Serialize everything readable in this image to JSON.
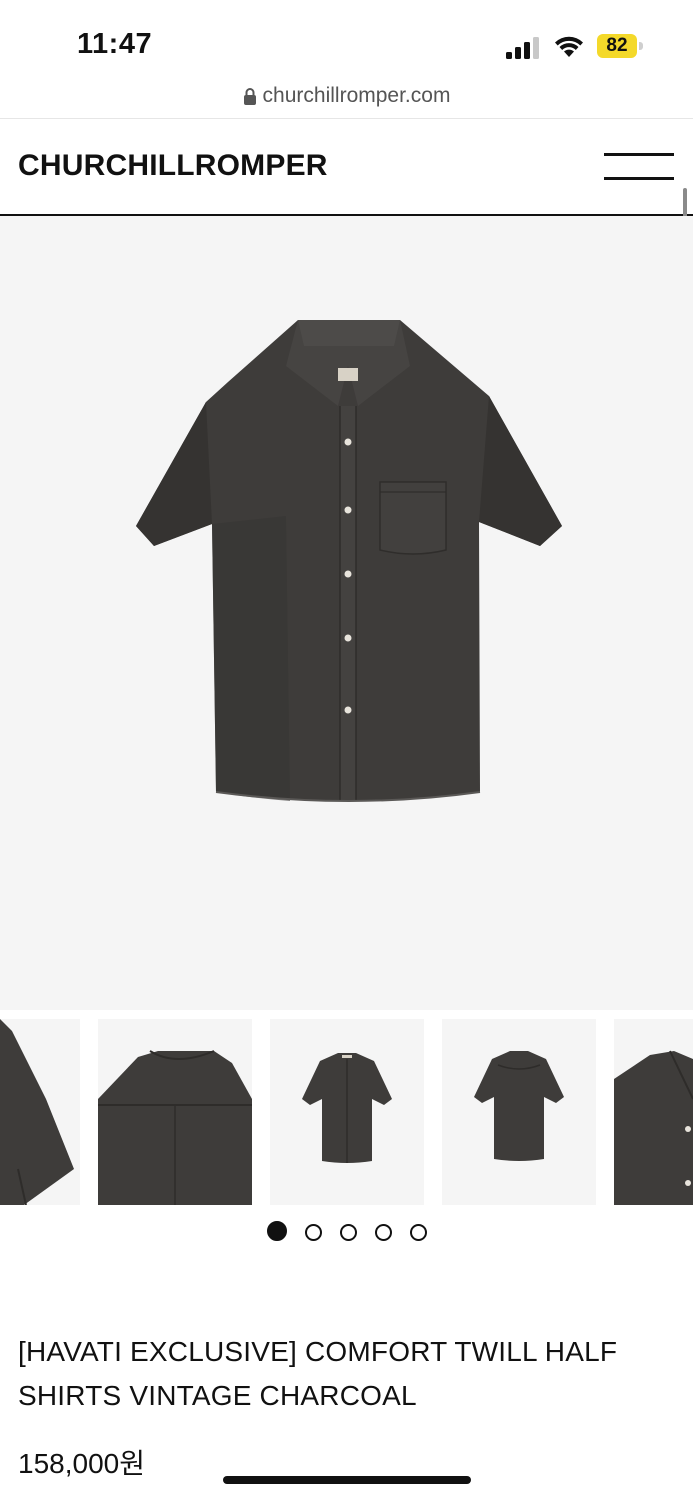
{
  "status_bar": {
    "time": "11:47",
    "battery_level": "82",
    "battery_color": "#f4d92a",
    "icons": [
      "cellular-signal-icon",
      "wifi-icon",
      "battery-icon"
    ]
  },
  "browser": {
    "url": "churchillromper.com",
    "lock_icon": "lock-icon"
  },
  "header": {
    "logo": "CHURCHILLROMPER",
    "menu_icon": "hamburger-menu-icon"
  },
  "gallery": {
    "main_image": "charcoal-short-sleeve-shirt-front",
    "thumbnails": [
      "shirt-sleeve-detail",
      "shirt-back-yoke-detail",
      "shirt-front-full",
      "shirt-back-full",
      "shirt-collar-detail"
    ],
    "pagination": {
      "count": 5,
      "active_index": 0
    }
  },
  "product": {
    "title": "[HAVATI EXCLUSIVE] COMFORT TWILL HALF SHIRTS VINTAGE CHARCOAL",
    "price": "158,000원"
  }
}
